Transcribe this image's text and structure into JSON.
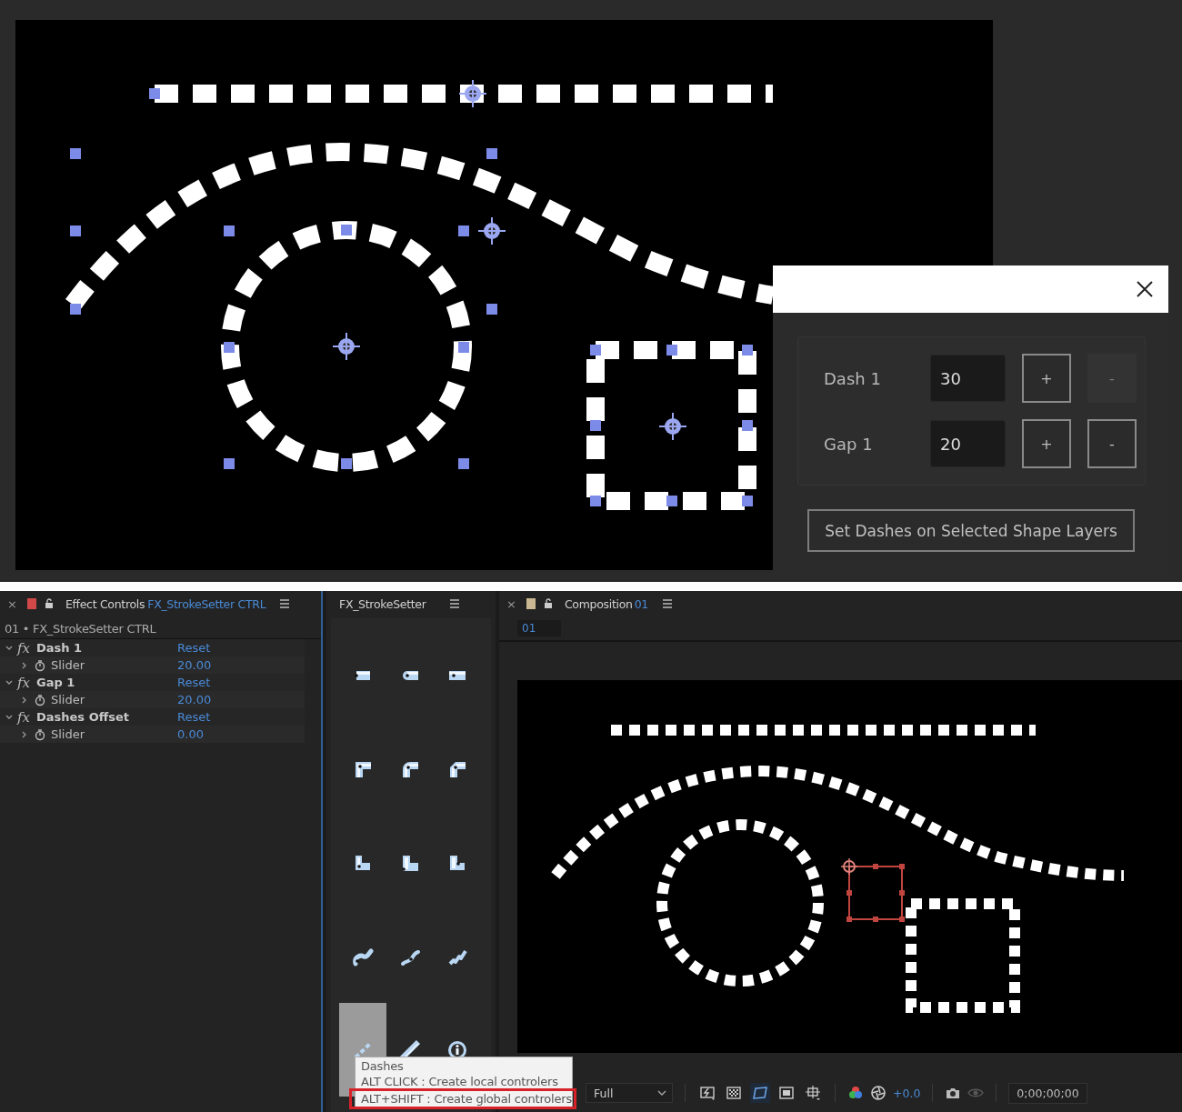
{
  "preview": {
    "dialog": {
      "rows": [
        {
          "label": "Dash 1",
          "value": "30",
          "plus": "+",
          "minus": "-",
          "minus_disabled": true
        },
        {
          "label": "Gap 1",
          "value": "20",
          "plus": "+",
          "minus": "-",
          "minus_disabled": false
        }
      ],
      "apply_button": "Set Dashes on Selected Shape Layers"
    }
  },
  "effect_controls": {
    "close": "×",
    "title": "Effect Controls",
    "layer": "FX_StrokeSetter CTRL",
    "header": "01 • FX_StrokeSetter CTRL",
    "effects": [
      {
        "badge": "fx",
        "name": "Dash 1",
        "reset": "Reset",
        "expanded": true,
        "children": [
          {
            "name": "Slider",
            "value": "20.00",
            "expanded": false
          }
        ]
      },
      {
        "badge": "fx",
        "name": "Gap 1",
        "reset": "Reset",
        "expanded": true,
        "children": [
          {
            "name": "Slider",
            "value": "20.00",
            "expanded": false
          }
        ]
      },
      {
        "badge": "fx",
        "name": "Dashes Offset",
        "reset": "Reset",
        "expanded": true,
        "children": [
          {
            "name": "Slider",
            "value": "0.00",
            "expanded": false
          }
        ]
      }
    ]
  },
  "stroke_setter": {
    "title": "FX_StrokeSetter",
    "buttons": [
      {
        "kind": "cap-butt",
        "selected": false
      },
      {
        "kind": "cap-round",
        "selected": false
      },
      {
        "kind": "cap-square",
        "selected": false
      },
      {
        "kind": "join-miter",
        "selected": false
      },
      {
        "kind": "join-round",
        "selected": false
      },
      {
        "kind": "join-bevel",
        "selected": false
      },
      {
        "kind": "corner-a",
        "selected": false
      },
      {
        "kind": "corner-b",
        "selected": false
      },
      {
        "kind": "corner-c",
        "selected": false
      },
      {
        "kind": "taper-a",
        "selected": false
      },
      {
        "kind": "taper-b",
        "selected": false
      },
      {
        "kind": "wave",
        "selected": false
      },
      {
        "kind": "dashes",
        "selected": true
      },
      {
        "kind": "stroke",
        "selected": false
      },
      {
        "kind": "info",
        "selected": false
      }
    ]
  },
  "tooltip": {
    "lines": [
      {
        "text": "Dashes",
        "highlighted": false
      },
      {
        "text": "ALT CLICK : Create local controlers",
        "highlighted": false
      },
      {
        "text": "ALT+SHIFT : Create global controlers",
        "highlighted": true
      }
    ]
  },
  "composition": {
    "close": "×",
    "title": "Composition",
    "name": "01",
    "subtab": "01",
    "toolbar": {
      "resolution": "Full",
      "view_icons": [
        {
          "kind": "fast-preview",
          "selected": false
        },
        {
          "kind": "transparency-grid",
          "selected": false
        },
        {
          "kind": "mask-path",
          "selected": true
        },
        {
          "kind": "region",
          "selected": false
        },
        {
          "kind": "guides",
          "selected": false
        }
      ],
      "color_icons": [
        {
          "kind": "channels"
        },
        {
          "kind": "exposure"
        }
      ],
      "exposure": "+0.0",
      "snapshot_icons": [
        {
          "kind": "snapshot",
          "disabled": false
        },
        {
          "kind": "show-snapshot",
          "disabled": true
        }
      ],
      "timecode": "0;00;00;00"
    }
  }
}
